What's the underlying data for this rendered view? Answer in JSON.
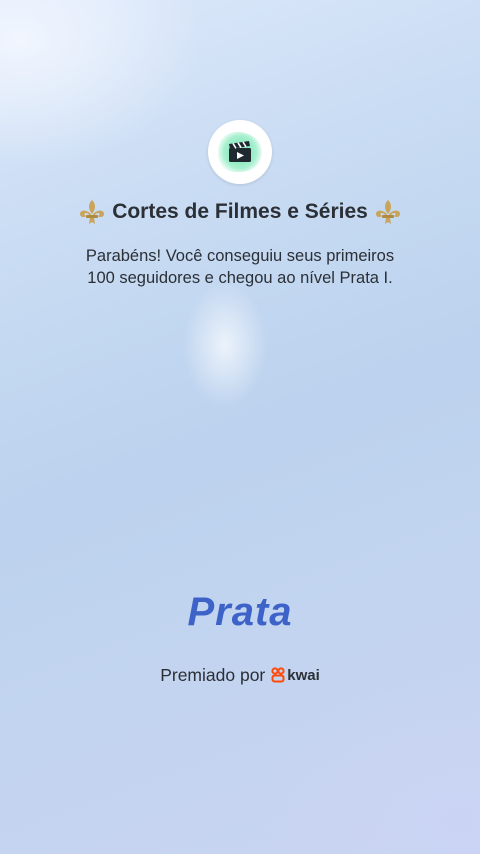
{
  "channel": {
    "name": "Cortes de Filmes e Séries",
    "avatar_icon": "clapperboard-icon",
    "decoration_icon": "fleur-de-lis-icon"
  },
  "message": {
    "line1": "Parabéns! Você conseguiu seus primeiros",
    "line2": "100 seguidores e chegou ao nível Prata I."
  },
  "level": {
    "name": "Prata"
  },
  "award": {
    "label": "Premiado por",
    "brand": "kwai",
    "brand_color": "#ff4906"
  },
  "colors": {
    "text": "#2b2f36",
    "level": "#3d63c9",
    "gold": "#c9a45a"
  }
}
